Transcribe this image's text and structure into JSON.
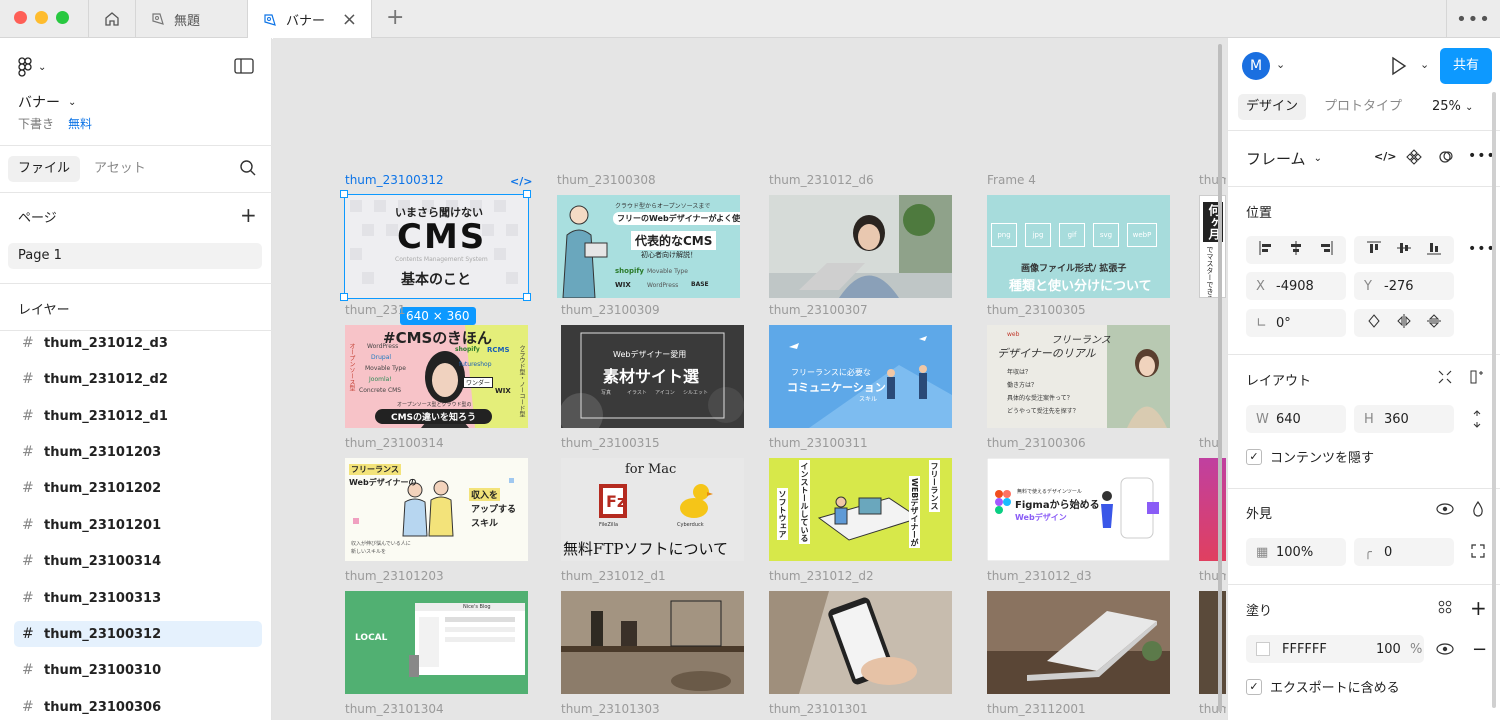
{
  "window": {
    "tabs": [
      {
        "label": "無題"
      },
      {
        "label": "バナー"
      }
    ]
  },
  "left_panel": {
    "file_name": "バナー",
    "draft_label": "下書き",
    "plan_label": "無料",
    "tab_files": "ファイル",
    "tab_assets": "アセット",
    "pages_title": "ページ",
    "pages": [
      "Page 1"
    ],
    "layers_title": "レイヤー",
    "layers": [
      "thum_231012_d3",
      "thum_231012_d2",
      "thum_231012_d1",
      "thum_23101203",
      "thum_23101202",
      "thum_23101201",
      "thum_23100314",
      "thum_23100313",
      "thum_23100312",
      "thum_23100310",
      "thum_23100306"
    ]
  },
  "canvas": {
    "frames": {
      "r0c0": "thum_23100312",
      "r0c1": "thum_23100308",
      "r0c2": "thum_231012_d6",
      "r0c3": "Frame 4",
      "r0c4": "thum",
      "r1c0": "thum_231",
      "r1c1": "thum_23100309",
      "r1c2": "thum_23100307",
      "r1c3": "thum_23100305",
      "r2c0": "thum_23100314",
      "r2c1": "thum_23100315",
      "r2c2": "thum_23100311",
      "r2c3": "thum_23100306",
      "r2c4": "thu",
      "r3c0": "thum_23101203",
      "r3c1": "thum_231012_d1",
      "r3c2": "thum_231012_d2",
      "r3c3": "thum_231012_d3",
      "r3c4": "thum",
      "r4c0": "thum_23101304",
      "r4c1": "thum_23101303",
      "r4c2": "thum_23101301",
      "r4c3": "thum_23112001",
      "r4c4": "thum"
    },
    "selection_size": "640 × 360",
    "thumb_text": {
      "cms_top": "いまさら聞けない",
      "cms_main": "CMS",
      "cms_sub": "Contents Management System",
      "cms_bottom": "基本のこと",
      "webd_top": "クラウド型からオープンソースまで",
      "webd_line": "フリーのWebデザイナーがよく使う",
      "webd_main": "代表的なCMS",
      "webd_sub": "初心者向け解説！",
      "webd_logo1": "shopify",
      "webd_logo2": "WIX",
      "webd_logo3": "Movable Type",
      "webd_logo4": "WordPress",
      "webd_logo5": "BASE",
      "fmt_boxes": [
        "png",
        "jpg",
        "gif",
        "svg",
        "webP"
      ],
      "fmt_top": "画像ファイル形式/ 拡張子",
      "fmt_main": "種類と使い分けについて",
      "vert_1": "何ヶ月",
      "vert_2": "でマスターできる？",
      "cmsk_title": "#CMSのきほん",
      "cmsk_list": [
        "WordPress",
        "Drupal",
        "Movable Type",
        "Joomla!",
        "Concrete CMS"
      ],
      "cmsk_right": [
        "shopify",
        "RCMS",
        "futureshop",
        "ワンダー",
        "WIX"
      ],
      "cmsk_side": "オープンソース型",
      "cmsk_side2": "クラウド型・ノーコード型",
      "cmsk_sub": "オープンソース型とクラウド型の",
      "cmsk_bottom": "CMSの違いを知ろう",
      "sozai_top": "Webデザイナー愛用",
      "sozai_main": "素材サイト選",
      "sozai_tags": [
        "写真",
        "イラスト",
        "アイコン",
        "シルエット"
      ],
      "comm_top": "フリーランスに必要な",
      "comm_main": "コミュニケーション",
      "comm_sub": "スキル",
      "real_webd": "web",
      "real_1": "フリーランス",
      "real_2": "デザイナーのリアル",
      "real_q": [
        "年収は？",
        "働き方は？",
        "具体的な受注案件って？",
        "どうやって受注先を探す？"
      ],
      "up_top": "フリーランス",
      "up_mid": "Webデザイナーの",
      "up_income": "収入を",
      "up_up": "アップする",
      "up_skill": "スキル",
      "up_small1": "収入が伸び悩んでいる人に",
      "up_small2": "新しいスキルを",
      "ftp_mac": "for Mac",
      "ftp_fz": "FileZilla",
      "ftp_cd": "Cyberduck",
      "ftp_main": "無料FTPソフトについて",
      "inst_v1": "インストールしている",
      "inst_v2": "ソフトウェア",
      "inst_v3": "フリーランス",
      "inst_v4": "WEBデザイナーが",
      "fig_small": "無料で使えるデザインツール",
      "fig_main": "Figmaから始める",
      "fig_sub": "Webデザイン",
      "local_logo": "LOCAL",
      "local_win": "Nice's Blog"
    }
  },
  "right_panel": {
    "avatar": "M",
    "share": "共有",
    "tab_design": "デザイン",
    "tab_proto": "プロトタイプ",
    "zoom": "25%",
    "frame_label": "フレーム",
    "position_title": "位置",
    "x_label": "X",
    "x_value": "-4908",
    "y_label": "Y",
    "y_value": "-276",
    "rotation": "0°",
    "layout_title": "レイアウト",
    "w_label": "W",
    "w_value": "640",
    "h_label": "H",
    "h_value": "360",
    "clip_label": "コンテンツを隠す",
    "appearance_title": "外見",
    "opacity": "100%",
    "radius": "0",
    "fill_title": "塗り",
    "fill_hex": "FFFFFF",
    "fill_opacity": "100",
    "fill_pct": "%",
    "export_label": "エクスポートに含める"
  },
  "colors": {
    "accent": "#0d99ff",
    "link": "#0d74e7"
  }
}
